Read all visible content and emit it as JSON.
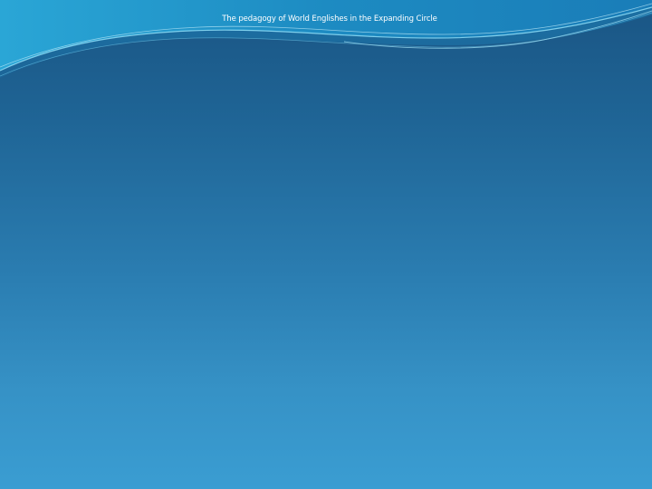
{
  "slide": {
    "title": "The pedagogy of World Englishes in the Expanding Circle"
  },
  "colors": {
    "background_top": "#1a5584",
    "background_bottom": "#3a9dd2",
    "header_wave": "#1f8fc4",
    "wave_highlight": "#7fd4f2"
  }
}
